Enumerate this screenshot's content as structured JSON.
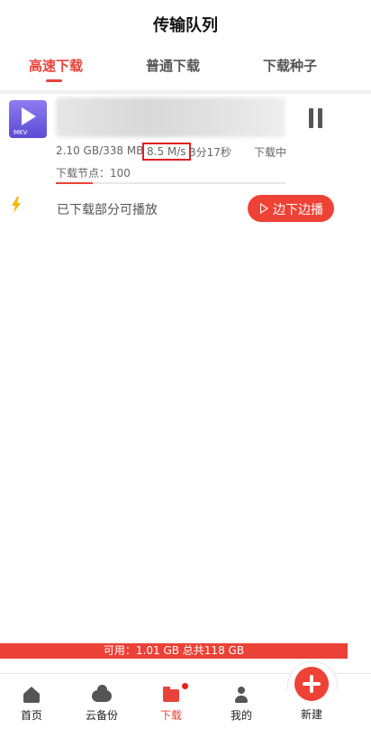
{
  "header": {
    "title": "传输队列"
  },
  "tabs": [
    {
      "label": "高速下载",
      "active": true
    },
    {
      "label": "普通下载",
      "active": false
    },
    {
      "label": "下载种子",
      "active": false
    }
  ],
  "download": {
    "file_type": "MKV",
    "icon": "video-file-icon",
    "filename": "",
    "size": "2.10 GB/338 MB",
    "speed": "8.5 M/s",
    "eta": "3分17秒",
    "status": "下载中",
    "nodes": "下载节点：100",
    "progress": 0.16
  },
  "playable": {
    "text": "已下载部分可播放",
    "button_label": "边下边播",
    "icon": "bolt-icon"
  },
  "storage": {
    "text": "可用：1.01 GB 总共118 GB"
  },
  "bottom_nav": [
    {
      "label": "首页",
      "icon": "home-icon"
    },
    {
      "label": "云备份",
      "icon": "cloud-icon"
    },
    {
      "label": "下载",
      "icon": "folder-icon",
      "active": true
    },
    {
      "label": "我的",
      "icon": "user-icon"
    },
    {
      "label": "新建",
      "icon": "plus-icon"
    }
  ],
  "colors": {
    "accent": "#e8433a",
    "badge": "#e8201a",
    "file_icon": "#6a5ae0"
  }
}
